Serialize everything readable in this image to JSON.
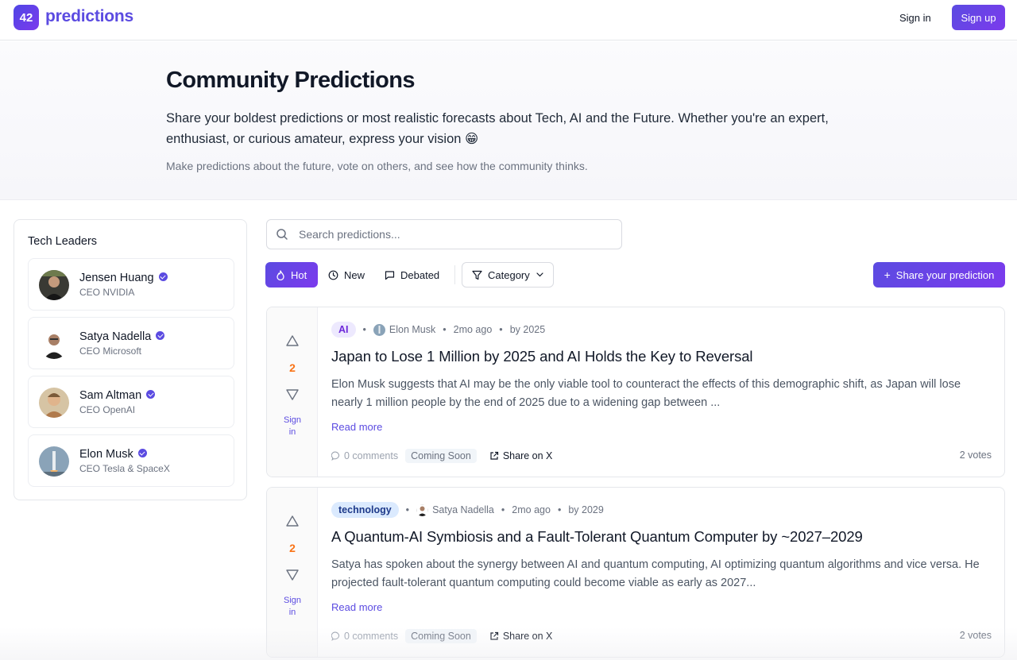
{
  "nav": {
    "logo_badge": "42",
    "logo_text": "predictions",
    "signin_label": "Sign in",
    "signup_label": "Sign up"
  },
  "hero": {
    "title": "Community Predictions",
    "description": "Share your boldest predictions or most realistic forecasts about Tech, AI and the Future. Whether you're an expert, enthusiast, or curious amateur, express your vision 😁",
    "subtitle": "Make predictions about the future, vote on others, and see how the community thinks."
  },
  "sidebar": {
    "title": "Tech Leaders",
    "leaders": [
      {
        "name": "Jensen Huang",
        "role": "CEO NVIDIA",
        "verified": true
      },
      {
        "name": "Satya Nadella",
        "role": "CEO Microsoft",
        "verified": true
      },
      {
        "name": "Sam Altman",
        "role": "CEO OpenAI",
        "verified": true
      },
      {
        "name": "Elon Musk",
        "role": "CEO Tesla & SpaceX",
        "verified": true
      }
    ]
  },
  "search": {
    "placeholder": "Search predictions...",
    "value": ""
  },
  "filters": {
    "hot": "Hot",
    "new": "New",
    "debated": "Debated",
    "category": "Category",
    "active": "hot"
  },
  "share_button": "Share your prediction",
  "colors": {
    "accent": "#5b4be1",
    "vote_count": "#f97316"
  },
  "predictions": [
    {
      "tag": "AI",
      "author": "Elon Musk",
      "time": "2mo ago",
      "target": "by 2025",
      "title": "Japan to Lose 1 Million by 2025 and AI Holds the Key to Reversal",
      "description": "Elon Musk suggests that AI may be the only viable tool to counteract the effects of this demographic shift, as Japan will lose nearly 1 million people by the end of 2025 due to a widening gap between ...",
      "read_more": "Read more",
      "score": "2",
      "sign_in": "Sign in",
      "comments": "0 comments",
      "badge": "Coming Soon",
      "share": "Share on X",
      "votes": "2 votes"
    },
    {
      "tag": "technology",
      "author": "Satya Nadella",
      "time": "2mo ago",
      "target": "by 2029",
      "title": "A Quantum-AI Symbiosis and a Fault-Tolerant Quantum Computer by ~2027–2029",
      "description": "Satya has spoken about the synergy between AI and quantum computing, AI optimizing quantum algorithms and vice versa. He projected fault-tolerant quantum computing could become viable as early as 2027...",
      "read_more": "Read more",
      "score": "2",
      "sign_in": "Sign in",
      "comments": "0 comments",
      "badge": "Coming Soon",
      "share": "Share on X",
      "votes": "2 votes"
    }
  ]
}
